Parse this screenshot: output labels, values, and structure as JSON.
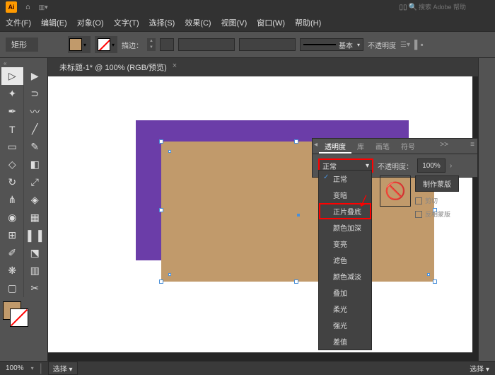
{
  "app": {
    "name": "Ai"
  },
  "search": {
    "placeholder": "搜索 Adobe 帮助"
  },
  "menubar": [
    "文件(F)",
    "编辑(E)",
    "对象(O)",
    "文字(T)",
    "选择(S)",
    "效果(C)",
    "视图(V)",
    "窗口(W)",
    "帮助(H)"
  ],
  "control": {
    "shape": "矩形",
    "stroke_label": "描边：",
    "style_label": "基本",
    "opacity_label": "不透明度"
  },
  "document": {
    "tab_title": "未标题-1* @ 100% (RGB/预览)",
    "close": "×"
  },
  "status": {
    "zoom": "100%",
    "select": "选择"
  },
  "panel": {
    "tabs": {
      "transparency": "透明度",
      "library": "库",
      "brushes": "画笔",
      "symbols": "符号",
      "more": ">>"
    },
    "blend_current": "正常",
    "opacity_label": "不透明度：",
    "opacity_value": "100%",
    "mask_btn": "制作蒙版",
    "clip": "剪切",
    "invert": "反相蒙版"
  },
  "blend_modes": {
    "normal": "正常",
    "darken": "变暗",
    "multiply": "正片叠底",
    "color_burn": "颜色加深",
    "lighten": "变亮",
    "screen": "滤色",
    "color_dodge": "颜色减淡",
    "overlay": "叠加",
    "soft_light": "柔光",
    "hard_light": "强光",
    "difference": "差值"
  },
  "colors": {
    "fill": "#c19a6b",
    "purple": "#6b3da8"
  }
}
